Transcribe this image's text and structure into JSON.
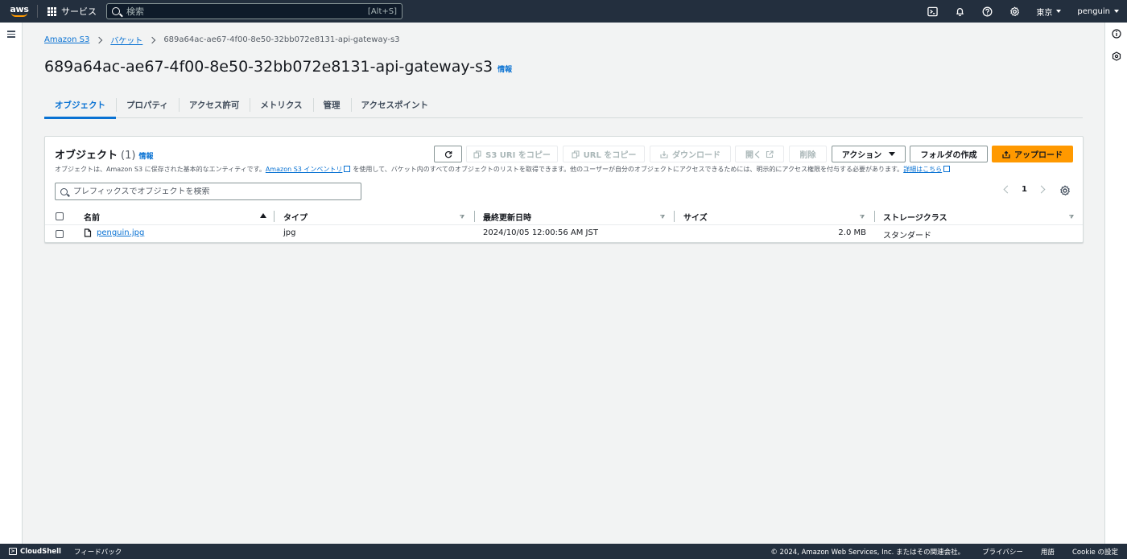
{
  "topnav": {
    "logo": "aws",
    "services_label": "サービス",
    "search_placeholder": "検索",
    "search_shortcut": "[Alt+S]",
    "region": "東京",
    "user": "penguin"
  },
  "breadcrumb": {
    "items": [
      "Amazon S3",
      "バケット"
    ],
    "current": "689a64ac-ae67-4f00-8e50-32bb072e8131-api-gateway-s3"
  },
  "page": {
    "title": "689a64ac-ae67-4f00-8e50-32bb072e8131-api-gateway-s3",
    "info": "情報"
  },
  "tabs": [
    {
      "label": "オブジェクト",
      "active": true
    },
    {
      "label": "プロパティ"
    },
    {
      "label": "アクセス許可"
    },
    {
      "label": "メトリクス"
    },
    {
      "label": "管理"
    },
    {
      "label": "アクセスポイント"
    }
  ],
  "objects_panel": {
    "title": "オブジェクト",
    "count": "(1)",
    "info": "情報",
    "desc_part1": "オブジェクトは、Amazon S3 に保存された基本的なエンティティです。",
    "desc_link1": "Amazon S3 インベントリ",
    "desc_part2": "を使用して、バケット内のすべてのオブジェクトのリストを取得できます。他のユーザーが自分のオブジェクトにアクセスできるためには、明示的にアクセス権限を付与する必要があります。",
    "desc_link2": "詳細はこちら",
    "buttons": {
      "copy_s3_uri": "S3 URI をコピー",
      "copy_url": "URL をコピー",
      "download": "ダウンロード",
      "open": "開く",
      "delete": "削除",
      "actions": "アクション",
      "create_folder": "フォルダの作成",
      "upload": "アップロード"
    },
    "filter_placeholder": "プレフィックスでオブジェクトを検索",
    "page_number": "1",
    "columns": [
      "名前",
      "タイプ",
      "最終更新日時",
      "サイズ",
      "ストレージクラス"
    ],
    "rows": [
      {
        "name": "penguin.jpg",
        "type": "jpg",
        "modified": "2024/10/05 12:00:56 AM JST",
        "size": "2.0 MB",
        "storage": "スタンダード"
      }
    ]
  },
  "footer": {
    "cloudshell": "CloudShell",
    "feedback": "フィードバック",
    "copyright": "© 2024, Amazon Web Services, Inc. またはその関連会社。",
    "privacy": "プライバシー",
    "terms": "用語",
    "cookie": "Cookie の設定"
  },
  "colors": {
    "nav_bg": "#232f3e",
    "link": "#0972d3",
    "primary": "#ff9900"
  },
  "icons": [
    "grid-icon",
    "search-icon",
    "cloudshell-icon",
    "notifications-icon",
    "help-icon",
    "settings-icon",
    "menu-icon",
    "info-icon",
    "location-icon",
    "refresh-icon",
    "copy-icon",
    "download-icon",
    "external-link-icon",
    "upload-icon",
    "file-icon",
    "gear-icon"
  ]
}
